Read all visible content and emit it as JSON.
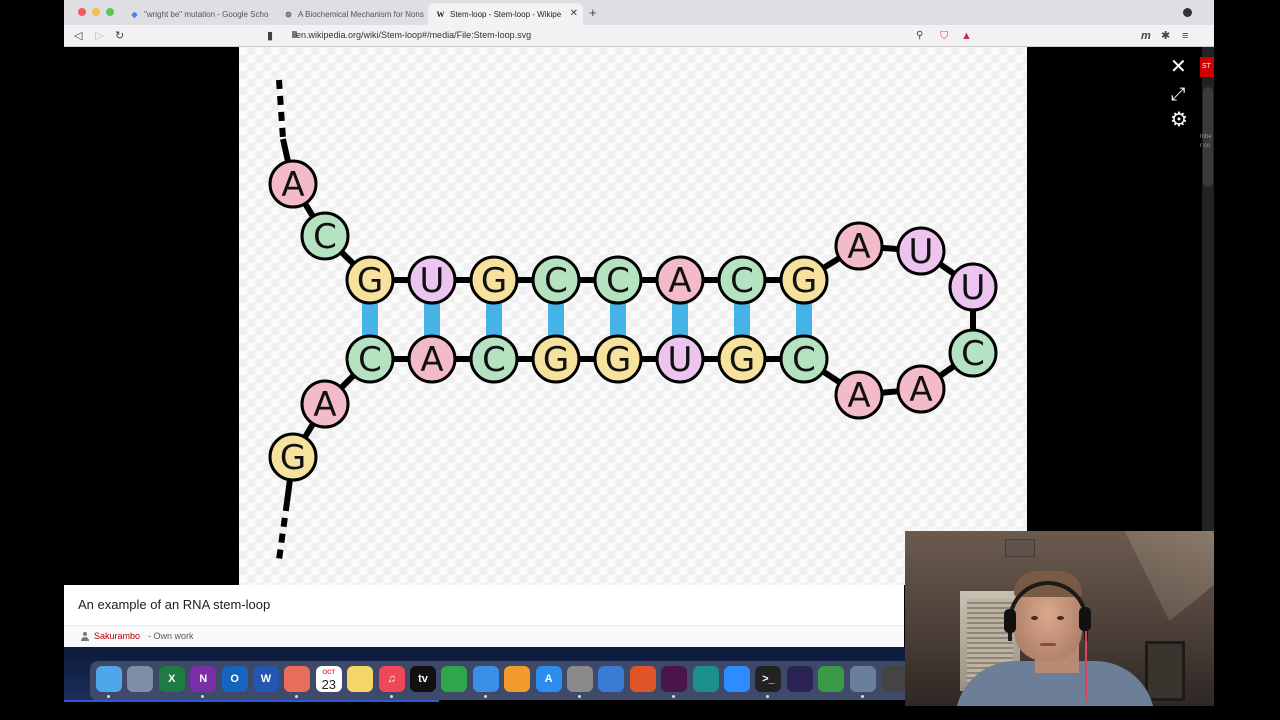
{
  "browser": {
    "tabs": [
      {
        "title": "\"wright be\" mutation - Google Scho",
        "icon": "google-scholar-icon"
      },
      {
        "title": "A Biochemical Mechanism for Nons",
        "icon": "page-icon"
      },
      {
        "title": "Stem-loop - Stem-loop - Wikipe",
        "icon": "wikipedia-icon",
        "active": true
      }
    ],
    "url": "en.wikipedia.org/wiki/Stem-loop#/media/File:Stem-loop.svg"
  },
  "media_viewer": {
    "caption": "An example of an RNA stem-loop",
    "author": "Sakurambo",
    "license_text": " - Own work",
    "side_badge": "ST",
    "side_text_1": "mbe",
    "side_text_2": "r co"
  },
  "diagram": {
    "nodes": [
      {
        "letter": "A",
        "color": "pink"
      },
      {
        "letter": "C",
        "color": "green"
      },
      {
        "letter": "G",
        "color": "yellow"
      },
      {
        "letter": "U",
        "color": "violet"
      },
      {
        "letter": "G",
        "color": "yellow"
      },
      {
        "letter": "C",
        "color": "green"
      },
      {
        "letter": "C",
        "color": "green"
      },
      {
        "letter": "A",
        "color": "pink"
      },
      {
        "letter": "C",
        "color": "green"
      },
      {
        "letter": "G",
        "color": "yellow"
      },
      {
        "letter": "A",
        "color": "pink"
      },
      {
        "letter": "U",
        "color": "violet"
      },
      {
        "letter": "U",
        "color": "violet"
      },
      {
        "letter": "C",
        "color": "green"
      },
      {
        "letter": "A",
        "color": "pink"
      },
      {
        "letter": "A",
        "color": "pink"
      },
      {
        "letter": "C",
        "color": "green"
      },
      {
        "letter": "G",
        "color": "yellow"
      },
      {
        "letter": "U",
        "color": "violet"
      },
      {
        "letter": "G",
        "color": "yellow"
      },
      {
        "letter": "G",
        "color": "yellow"
      },
      {
        "letter": "C",
        "color": "green"
      },
      {
        "letter": "A",
        "color": "pink"
      },
      {
        "letter": "C",
        "color": "green"
      },
      {
        "letter": "A",
        "color": "pink"
      },
      {
        "letter": "G",
        "color": "yellow"
      }
    ],
    "colors": {
      "pink": "#f3bac8",
      "green": "#b5e3c2",
      "yellow": "#f6e29c",
      "violet": "#ecc4ef",
      "bond": "#46b3e6",
      "stroke": "#000000"
    }
  },
  "dock": {
    "calendar_month": "OCT",
    "calendar_day": "23",
    "apps": [
      {
        "icon": "finder-icon",
        "color": "#4fa6e8"
      },
      {
        "icon": "launchpad-icon",
        "color": "#7d8ea6"
      },
      {
        "icon": "excel-icon",
        "color": "#1f7a45",
        "label": "X"
      },
      {
        "icon": "onenote-icon",
        "color": "#7a2fa8",
        "label": "N"
      },
      {
        "icon": "outlook-icon",
        "color": "#1565c0",
        "label": "O"
      },
      {
        "icon": "word-icon",
        "color": "#2356b0",
        "label": "W"
      },
      {
        "icon": "photos-icon",
        "color": "#e96d5b"
      },
      {
        "icon": "calendar-icon",
        "color": "#ffffff"
      },
      {
        "icon": "notes-icon",
        "color": "#f5d66a"
      },
      {
        "icon": "music-icon",
        "color": "#f04858",
        "label": "♫"
      },
      {
        "icon": "apple-tv-icon",
        "color": "#111111",
        "label": "tv"
      },
      {
        "icon": "numbers-icon",
        "color": "#2fa64a"
      },
      {
        "icon": "keynote-icon",
        "color": "#3a8ee6"
      },
      {
        "icon": "pages-icon",
        "color": "#f39a2c"
      },
      {
        "icon": "app-store-icon",
        "color": "#2d8cf0",
        "label": "A"
      },
      {
        "icon": "system-preferences-icon",
        "color": "#8a8a8a"
      },
      {
        "icon": "xcode-icon",
        "color": "#3a7bd5"
      },
      {
        "icon": "brave-icon",
        "color": "#e0542a"
      },
      {
        "icon": "slack-icon",
        "color": "#4a154b"
      },
      {
        "icon": "perplexity-icon",
        "color": "#1b8f8a"
      },
      {
        "icon": "zoom-icon",
        "color": "#2d8cff"
      },
      {
        "icon": "terminal-icon",
        "color": "#222222",
        "label": ">_"
      },
      {
        "icon": "eclipse-icon",
        "color": "#2c2255"
      },
      {
        "icon": "vim-icon",
        "color": "#3a9a47"
      },
      {
        "icon": "preview-icon",
        "color": "#6a7f9a"
      },
      {
        "icon": "clock-icon",
        "color": "#444444"
      }
    ]
  }
}
